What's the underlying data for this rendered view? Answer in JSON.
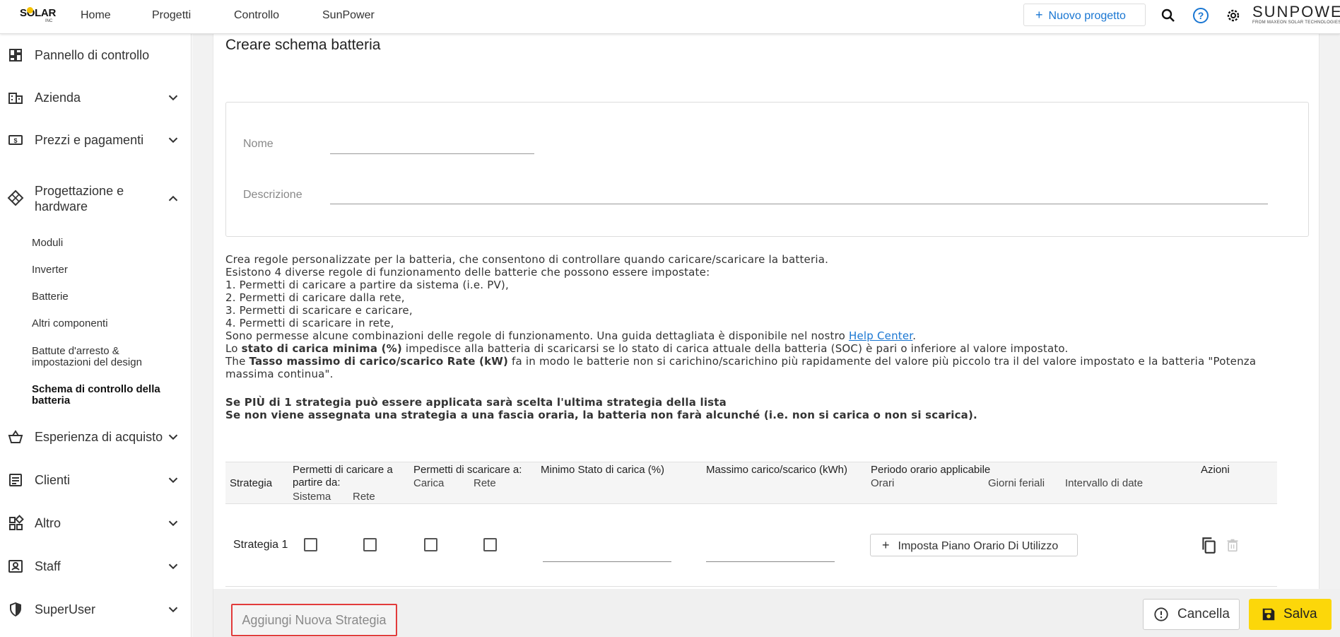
{
  "header": {
    "logo_text": "SOLAR",
    "logo_sub": "INC",
    "nav": [
      "Home",
      "Progetti",
      "Controllo",
      "SunPower"
    ],
    "new_project": "Nuovo progetto",
    "brand_name": "SUNPOWER",
    "brand_tagline": "FROM MAXEON SOLAR TECHNOLOGIES",
    "icons": [
      "search-icon",
      "help-icon",
      "gear-icon"
    ],
    "accent_color": "#1976d2"
  },
  "sidebar": {
    "items": [
      {
        "label": "Pannello di controllo",
        "icon": "dashboard-icon"
      },
      {
        "label": "Azienda",
        "icon": "building-icon"
      },
      {
        "label": "Prezzi e pagamenti",
        "icon": "money-icon"
      },
      {
        "label": "Progettazione e hardware",
        "icon": "grid-icon"
      },
      {
        "label": "Esperienza di acquisto",
        "icon": "basket-icon"
      },
      {
        "label": "Clienti",
        "icon": "list-icon"
      },
      {
        "label": "Altro",
        "icon": "widgets-icon"
      },
      {
        "label": "Staff",
        "icon": "badge-icon"
      },
      {
        "label": "SuperUser",
        "icon": "shield-icon"
      }
    ],
    "subitems": [
      "Moduli",
      "Inverter",
      "Batterie",
      "Altri componenti",
      "Battute d'arresto & impostazioni del design",
      "Schema di controllo della batteria"
    ],
    "active_subitem": "Schema di controllo della batteria"
  },
  "page": {
    "title": "Creare schema batteria",
    "name_label": "Nome",
    "description_label": "Descrizione",
    "description_lines": [
      "Crea regole personalizzate per la batteria, che consentono di controllare quando caricare/scaricare la batteria.",
      "Esistono 4 diverse regole di funzionamento delle batterie che possono essere impostate:",
      "1. Permetti di caricare a partire da sistema (i.e. PV),",
      "2. Permetti di caricare dalla rete,",
      "3. Permetti di scaricare e caricare,",
      "4. Permetti di scaricare in rete,"
    ],
    "help_prefix": "Sono permesse alcune combinazioni delle regole di funzionamento. Una guida dettagliata è disponibile nel nostro ",
    "help_link": "Help Center",
    "help_suffix": ".",
    "soc_prefix": "Lo ",
    "soc_bold": "stato di carica minima (%)",
    "soc_suffix": " impedisce alla batteria di scaricarsi se lo stato di carica attuale della batteria (SOC) è pari o inferiore al valore impostato.",
    "rate_prefix": "The ",
    "rate_bold": "Tasso massimo di carico/scarico Rate (kW)",
    "rate_suffix": " fa in modo le batterie non si carichino/scarichino più rapidamente del valore più piccolo tra il del valore impostato e la batteria \"Potenza massima continua\".",
    "warning_1": "Se PIÙ di 1 strategia può essere applicata sarà scelta l'ultima strategia della lista",
    "warning_2": "Se non viene assegnata una strategia a una fascia oraria, la batteria non farà alcunché (i.e. non si carica o non si scarica)."
  },
  "table": {
    "headers": {
      "strategy": "Strategia",
      "charge_from": "Permetti di caricare a partire da:",
      "charge_system": "Sistema",
      "charge_grid": "Rete",
      "discharge_to": "Permetti di scaricare a:",
      "discharge_charge": "Carica",
      "discharge_grid": "Rete",
      "min_soc": "Minimo Stato di carica (%)",
      "max_rate": "Massimo carico/scarico (kWh)",
      "period": "Periodo orario applicabile",
      "hours": "Orari",
      "weekdays": "Giorni feriali",
      "dates": "Intervallo di date",
      "actions": "Azioni"
    },
    "rows": [
      {
        "name": "Strategia 1",
        "tou_button": "Imposta Piano Orario Di Utilizzo"
      }
    ]
  },
  "footer": {
    "add_strategy": "Aggiungi Nuova Strategia",
    "cancel": "Cancella",
    "save": "Salva",
    "save_color": "#fcd70a"
  }
}
